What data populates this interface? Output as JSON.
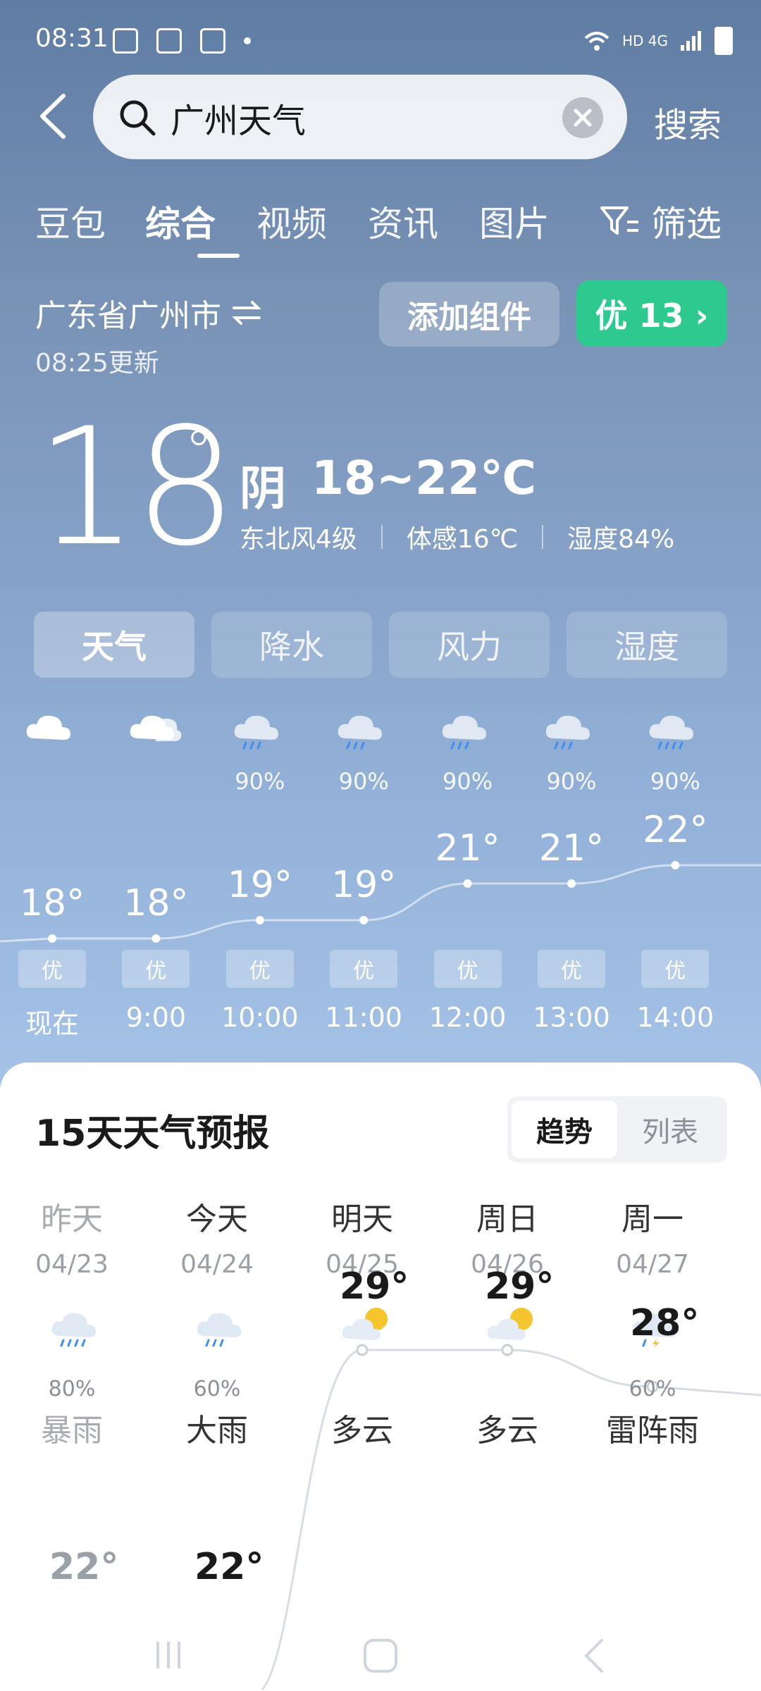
{
  "status": {
    "time": "08:31",
    "network": "HD 4G"
  },
  "search": {
    "query": "广州天气",
    "button": "搜索"
  },
  "tabs": [
    "豆包",
    "综合",
    "视频",
    "资讯",
    "图片"
  ],
  "filter_label": "筛选",
  "location": {
    "name": "广东省广州市",
    "updated": "08:25更新"
  },
  "add_widget": "添加组件",
  "aqi": "优 13 ›",
  "current": {
    "temp": "18",
    "deg": "°",
    "condition": "阴",
    "range": "18~22℃",
    "wind": "东北风4级",
    "feels": "体感16℃",
    "humidity": "湿度84%"
  },
  "metric_tabs": [
    "天气",
    "降水",
    "风力",
    "湿度"
  ],
  "hourly": [
    {
      "time": "现在",
      "temp": "18°",
      "precip": "",
      "aqi": "优",
      "icon": "cloud-icon"
    },
    {
      "time": "9:00",
      "temp": "18°",
      "precip": "",
      "aqi": "优",
      "icon": "cloudy-icon"
    },
    {
      "time": "10:00",
      "temp": "19°",
      "precip": "90%",
      "aqi": "优",
      "icon": "rain-icon"
    },
    {
      "time": "11:00",
      "temp": "19°",
      "precip": "90%",
      "aqi": "优",
      "icon": "rain-icon"
    },
    {
      "time": "12:00",
      "temp": "21°",
      "precip": "90%",
      "aqi": "优",
      "icon": "rain-icon"
    },
    {
      "time": "13:00",
      "temp": "21°",
      "precip": "90%",
      "aqi": "优",
      "icon": "rain-icon"
    },
    {
      "time": "14:00",
      "temp": "22°",
      "precip": "90%",
      "aqi": "优",
      "icon": "heavy-rain-icon"
    }
  ],
  "forecast": {
    "title": "15天天气预报",
    "view_options": [
      "趋势",
      "列表"
    ],
    "days": [
      {
        "name": "昨天",
        "date": "04/23",
        "precip": "80%",
        "condition": "暴雨",
        "high": "",
        "low": "22°",
        "icon": "heavy-rain-icon"
      },
      {
        "name": "今天",
        "date": "04/24",
        "precip": "60%",
        "condition": "大雨",
        "high": "",
        "low": "22°",
        "icon": "rain-icon"
      },
      {
        "name": "明天",
        "date": "04/25",
        "precip": "",
        "condition": "多云",
        "high": "29°",
        "low": "",
        "icon": "partly-cloudy-icon"
      },
      {
        "name": "周日",
        "date": "04/26",
        "precip": "",
        "condition": "多云",
        "high": "29°",
        "low": "",
        "icon": "partly-cloudy-icon"
      },
      {
        "name": "周一",
        "date": "04/27",
        "precip": "60%",
        "condition": "雷阵雨",
        "high": "28°",
        "low": "",
        "icon": "thunderstorm-icon"
      }
    ]
  },
  "colors": {
    "aqi_good": "#2ec98f",
    "panel_bg": "#ffffff"
  }
}
